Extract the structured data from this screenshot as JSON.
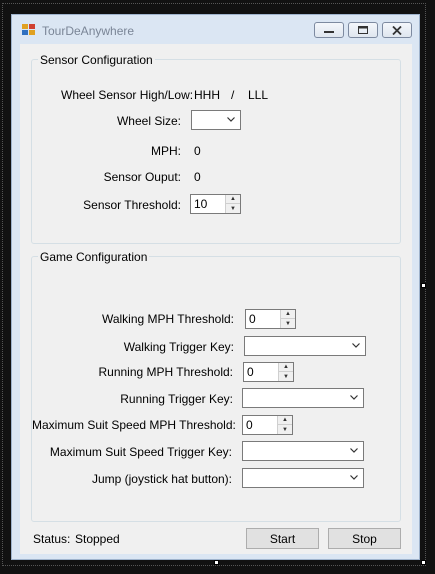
{
  "window": {
    "title": "TourDeAnywhere"
  },
  "sensor": {
    "group_title": "Sensor Configuration",
    "wheel_sensor_label": "Wheel Sensor High/Low:",
    "high_value": "HHH",
    "separator": "/",
    "low_value": "LLL",
    "wheel_size_label": "Wheel Size:",
    "wheel_size_value": "",
    "mph_label": "MPH:",
    "mph_value": "0",
    "output_label": "Sensor Ouput:",
    "output_value": "0",
    "threshold_label": "Sensor Threshold:",
    "threshold_value": "10"
  },
  "game": {
    "group_title": "Game Configuration",
    "walking_threshold_label": "Walking MPH Threshold:",
    "walking_threshold_value": "0",
    "walking_key_label": "Walking Trigger Key:",
    "walking_key_value": "",
    "running_threshold_label": "Running MPH Threshold:",
    "running_threshold_value": "0",
    "running_key_label": "Running Trigger Key:",
    "running_key_value": "",
    "max_threshold_label": "Maximum Suit Speed MPH Threshold:",
    "max_threshold_value": "0",
    "max_key_label": "Maximum Suit Speed Trigger Key:",
    "max_key_value": "",
    "jump_label": "Jump (joystick hat button):",
    "jump_value": ""
  },
  "status": {
    "label": "Status:",
    "value": "Stopped"
  },
  "buttons": {
    "start": "Start",
    "stop": "Stop"
  }
}
